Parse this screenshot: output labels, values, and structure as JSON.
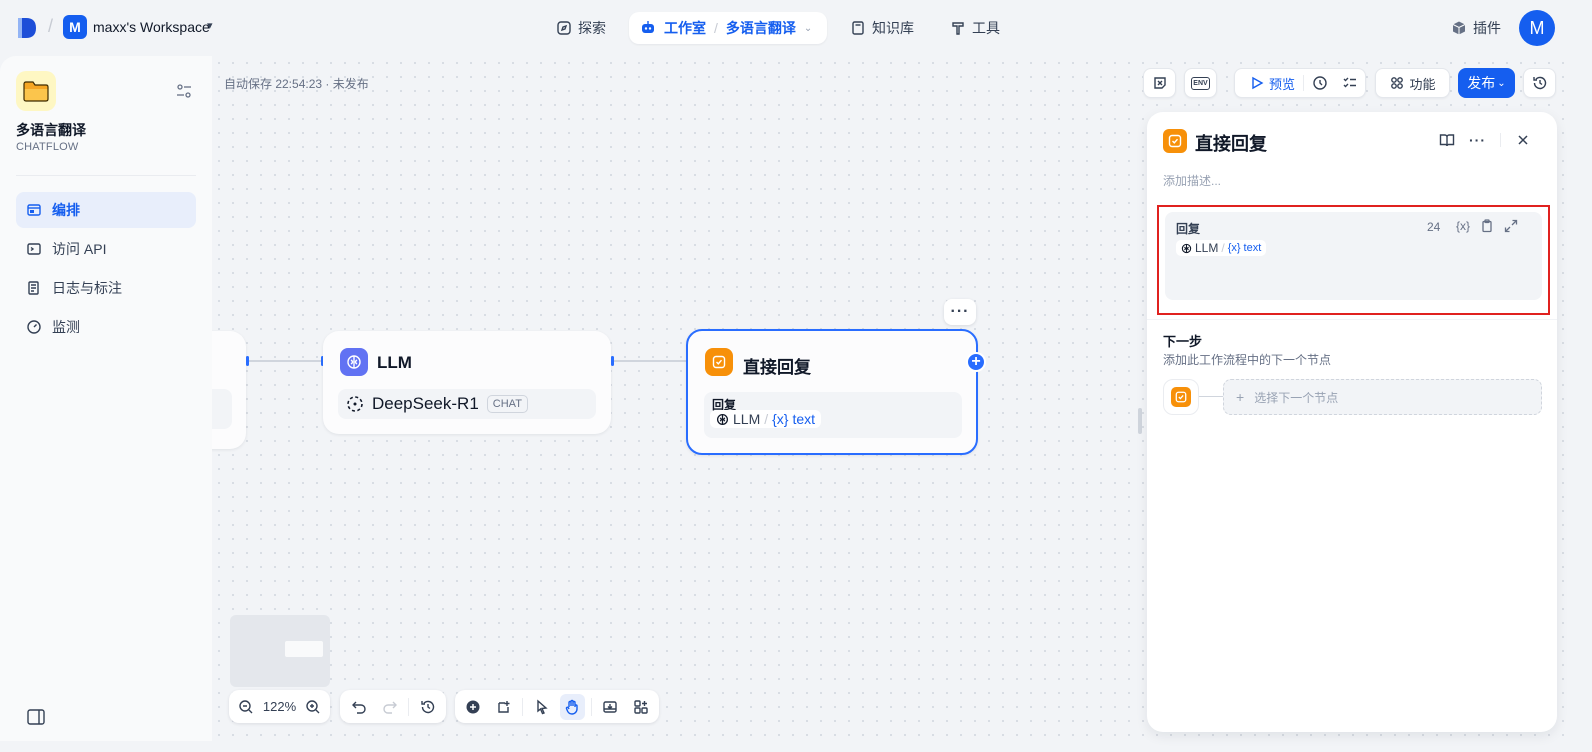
{
  "topbar": {
    "workspace_initial": "M",
    "workspace_name": "maxx's Workspace",
    "nav": {
      "explore": "探索",
      "studio": "工作室",
      "current_app": "多语言翻译",
      "knowledge": "知识库",
      "tools": "工具"
    },
    "plugins": "插件",
    "avatar_initial": "M"
  },
  "sidebar": {
    "app_name": "多语言翻译",
    "app_mode": "CHATFLOW",
    "items": [
      {
        "label": "编排",
        "icon": "layout-icon",
        "active": true
      },
      {
        "label": "访问 API",
        "icon": "terminal-icon",
        "active": false
      },
      {
        "label": "日志与标注",
        "icon": "document-icon",
        "active": false
      },
      {
        "label": "监测",
        "icon": "gauge-icon",
        "active": false
      }
    ]
  },
  "toolbar": {
    "autosave": "自动保存 22:54:23 · 未发布",
    "preview": "预览",
    "features": "功能",
    "publish": "发布",
    "env_label": "ENV"
  },
  "canvas": {
    "llm_node": {
      "title": "LLM",
      "model": "DeepSeek-R1",
      "tag": "CHAT"
    },
    "reply_node": {
      "title": "直接回复",
      "field_label": "回复",
      "var_source": "LLM",
      "var_name": "text",
      "var_prefix": "{x}"
    },
    "zoom": "122%"
  },
  "panel": {
    "title": "直接回复",
    "desc_placeholder": "添加描述...",
    "reply_label": "回复",
    "char_count": "24",
    "var_prefix": "{x}",
    "var_source": "LLM",
    "var_name": "text",
    "next_title": "下一步",
    "next_desc": "添加此工作流程中的下一个节点",
    "next_select": "选择下一个节点"
  },
  "colors": {
    "accent": "#155eef",
    "reply_node_icon": "#f79009",
    "llm_node_icon": "#6172f3",
    "highlight_border": "#e0211f"
  }
}
